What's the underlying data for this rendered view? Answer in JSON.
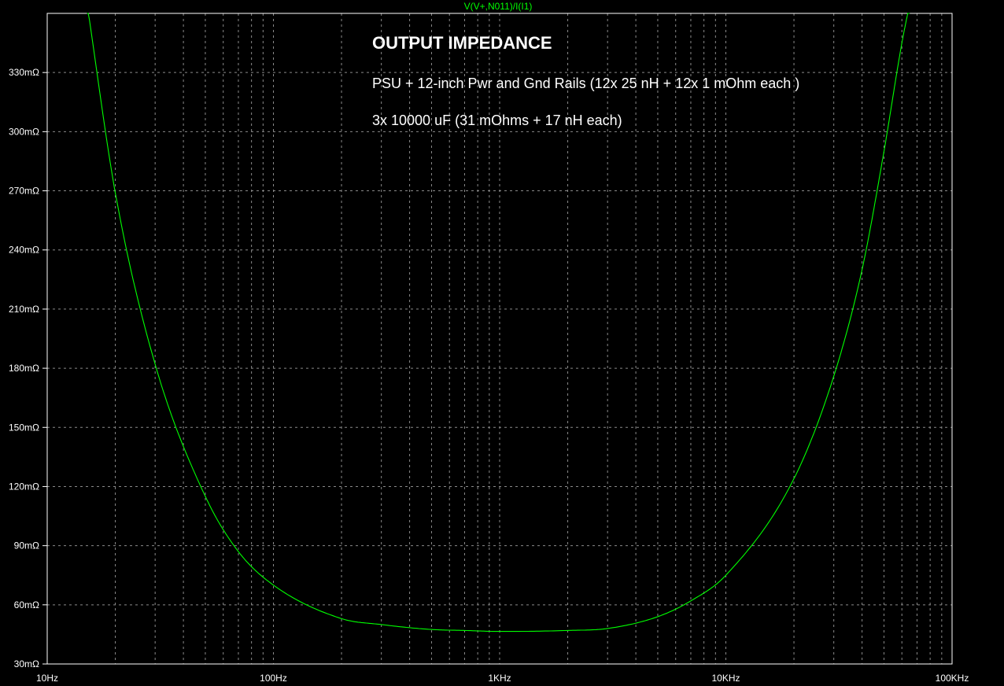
{
  "chart_data": {
    "type": "line",
    "title": "V(V+,N011)/I(I1)",
    "xscale": "log",
    "xlim": [
      10,
      100000
    ],
    "ylim": [
      30,
      360
    ],
    "grid": true,
    "x_ticks": [
      {
        "value": 10,
        "label": "10Hz"
      },
      {
        "value": 100,
        "label": "100Hz"
      },
      {
        "value": 1000,
        "label": "1KHz"
      },
      {
        "value": 10000,
        "label": "10KHz"
      },
      {
        "value": 100000,
        "label": "100KHz"
      }
    ],
    "y_ticks": [
      {
        "value": 30,
        "label": "30mΩ"
      },
      {
        "value": 60,
        "label": "60mΩ"
      },
      {
        "value": 90,
        "label": "90mΩ"
      },
      {
        "value": 120,
        "label": "120mΩ"
      },
      {
        "value": 150,
        "label": "150mΩ"
      },
      {
        "value": 180,
        "label": "180mΩ"
      },
      {
        "value": 210,
        "label": "210mΩ"
      },
      {
        "value": 240,
        "label": "240mΩ"
      },
      {
        "value": 270,
        "label": "270mΩ"
      },
      {
        "value": 300,
        "label": "300mΩ"
      },
      {
        "value": 330,
        "label": "330mΩ"
      }
    ],
    "annotations": [
      "OUTPUT IMPEDANCE",
      "PSU + 12-inch  Pwr and Gnd Rails (12x 25 nH  +  12x 1 mOhm each )",
      "3x 10000 uF  (31 mOhms + 17 nH each)"
    ],
    "series": [
      {
        "color": "#00ff00",
        "x": [
          15,
          20,
          30,
          50,
          70,
          100,
          200,
          300,
          500,
          700,
          1000,
          2000,
          3000,
          5000,
          7000,
          10000,
          20000,
          30000,
          40000,
          50000,
          60000,
          65000
        ],
        "y": [
          365,
          269,
          182,
          115,
          87,
          70,
          53,
          50,
          47.5,
          47,
          46.5,
          47,
          48,
          54,
          62,
          75,
          124,
          176,
          230,
          290,
          345,
          365
        ]
      }
    ]
  }
}
